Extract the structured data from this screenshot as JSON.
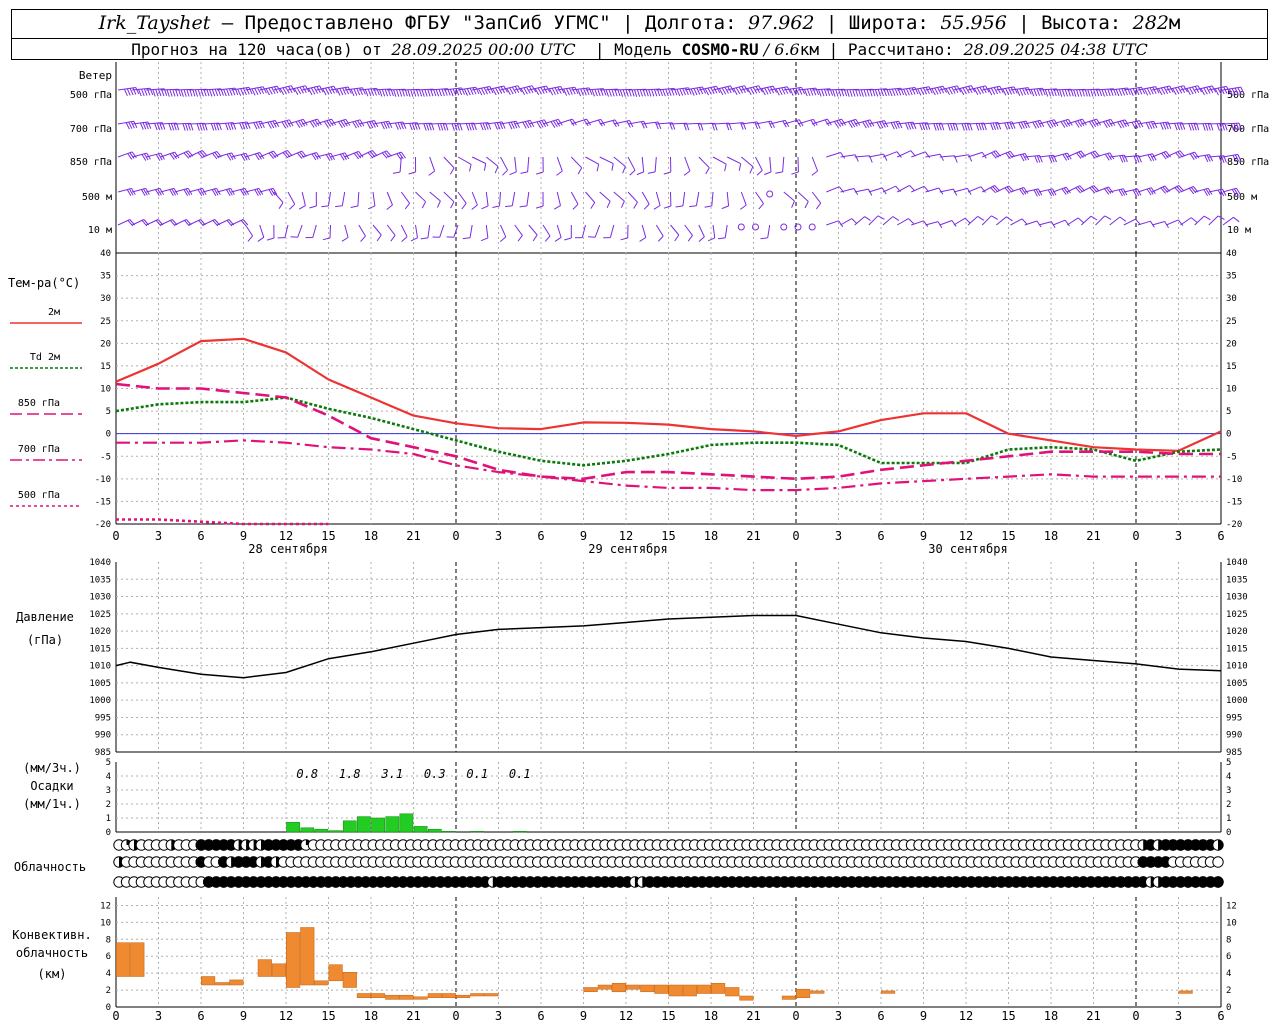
{
  "header": {
    "station": "Irk_Tayshet",
    "provider": " — Предоставлено ФГБУ \"ЗапСиб УГМС\" | Долгота: ",
    "lon": "97.962",
    "lat_label": " | Широта: ",
    "lat": "55.956",
    "alt_label": " | Высота: ",
    "alt": "282",
    "alt_unit": "м",
    "forecast_prefix": "Прогноз на 120 часа(ов) от ",
    "forecast_start": "28.09.2025 00:00 UTC",
    "model_label": "  | Модель ",
    "model": "COSMO-RU",
    "resolution": " / 6.6",
    "res_unit": "км",
    "computed_label": " | Рассчитано: ",
    "computed": "28.09.2025 04:38 UTC"
  },
  "labels": {
    "wind": "Ветер",
    "levels": [
      "500 гПа",
      "700 гПа",
      "850 гПа",
      "500 м",
      "10 м"
    ],
    "temp_title": "Тем-ра(°C)",
    "legend": [
      {
        "label": "2м",
        "color": "#ee3333",
        "dash": ""
      },
      {
        "label": "Td 2м",
        "color": "#0a7a0a",
        "dash": "3,2"
      },
      {
        "label": "850 гПа",
        "color": "#e0127a",
        "dash": "12,5"
      },
      {
        "label": "700 гПа",
        "color": "#e0127a",
        "dash": "12,4,3,4"
      },
      {
        "label": "500 гПа",
        "color": "#e0127a",
        "dash": "3,3"
      }
    ],
    "pressure_title": "Давление",
    "pressure_unit": "(гПа)",
    "precip_unit3": "(мм/3ч.)",
    "precip_title": "Осадки",
    "precip_unit1": "(мм/1ч.)",
    "cloud_title": "Облачность",
    "conv_title1": "Конвективн.",
    "conv_title2": "облачность",
    "conv_unit": "(км)",
    "hour_ticks": [
      "0",
      "3",
      "6",
      "9",
      "12",
      "15",
      "18",
      "21",
      "0",
      "3",
      "6",
      "9",
      "12",
      "15",
      "18",
      "21",
      "0",
      "3",
      "6",
      "9",
      "12",
      "15",
      "18",
      "21",
      "0",
      "3",
      "6"
    ],
    "days": [
      "28 сентября",
      "29 сентября",
      "30 сентября"
    ]
  },
  "chart_data": [
    {
      "type": "line",
      "name": "temperature",
      "ylim": [
        -20,
        40
      ],
      "yticks": [
        "-20",
        "-15",
        "-10",
        "-5",
        "0",
        "5",
        "10",
        "15",
        "20",
        "25",
        "30",
        "35",
        "40"
      ],
      "x_hours": [
        0,
        3,
        6,
        9,
        12,
        15,
        18,
        21,
        24,
        27,
        30,
        33,
        36,
        39,
        42,
        45,
        48,
        51,
        54,
        57,
        60,
        63,
        66,
        69,
        72,
        75,
        78
      ],
      "series": [
        {
          "name": "2м",
          "color": "#ee3333",
          "values": [
            11.5,
            15.5,
            20.5,
            21,
            18,
            12,
            8,
            4,
            2.3,
            1.2,
            1,
            2.5,
            2.4,
            2,
            1,
            0.5,
            -0.5,
            0.5,
            3,
            4.5,
            4.5,
            0,
            -1.5,
            -3,
            -3.5,
            -3.8,
            0.5,
            5
          ]
        },
        {
          "name": "Td 2м",
          "color": "#0a7a0a",
          "values": [
            5,
            6.5,
            7,
            7,
            8,
            5.5,
            3.5,
            1,
            -1.5,
            -4,
            -6,
            -7,
            -6,
            -4.5,
            -2.5,
            -2,
            -2,
            -2.5,
            -6.5,
            -6.5,
            -6.5,
            -3.5,
            -3,
            -3.5,
            -6,
            -4,
            -3.5
          ]
        },
        {
          "name": "850 гПа",
          "color": "#e0127a",
          "values": [
            11,
            10,
            10,
            9,
            8,
            4,
            -1,
            -3,
            -5,
            -8,
            -9.5,
            -10,
            -8.5,
            -8.5,
            -9,
            -9.5,
            -10,
            -9.5,
            -8,
            -7,
            -6,
            -5,
            -4,
            -4,
            -4,
            -4.5,
            -4.5
          ]
        },
        {
          "name": "700 гПа",
          "color": "#e0127a",
          "values": [
            -2,
            -2,
            -2,
            -1.5,
            -2,
            -3,
            -3.5,
            -4.5,
            -7,
            -8.5,
            -9.5,
            -10.5,
            -11.5,
            -12,
            -12,
            -12.5,
            -12.5,
            -12,
            -11,
            -10.5,
            -10,
            -9.5,
            -9,
            -9.5,
            -9.5,
            -9.5,
            -9.5
          ]
        },
        {
          "name": "500 гПа",
          "color": "#e0127a",
          "values": [
            -19,
            -19,
            -19.5,
            -20,
            -20,
            -20,
            null,
            null,
            null,
            null,
            null,
            null,
            null,
            null,
            null,
            null,
            null,
            null,
            null,
            null,
            null,
            null,
            null,
            null,
            null,
            null,
            null
          ]
        }
      ]
    },
    {
      "type": "line",
      "name": "pressure",
      "ylim": [
        985,
        1040
      ],
      "yticks": [
        "985",
        "990",
        "995",
        "1000",
        "1005",
        "1010",
        "1015",
        "1020",
        "1025",
        "1030",
        "1035",
        "1040"
      ],
      "x_hours": [
        0,
        1,
        3,
        6,
        9,
        12,
        15,
        18,
        21,
        24,
        27,
        30,
        33,
        36,
        39,
        42,
        45,
        48,
        51,
        54,
        57,
        60,
        63,
        66,
        69,
        72,
        75,
        78
      ],
      "values": [
        1010,
        1011,
        1009.5,
        1007.5,
        1006.5,
        1008,
        1012,
        1014,
        1016.5,
        1019,
        1020.5,
        1021,
        1021.5,
        1022.5,
        1023.5,
        1024,
        1024.5,
        1024.5,
        1022,
        1019.5,
        1018,
        1017,
        1015,
        1012.5,
        1011.5,
        1010.5,
        1009,
        1008.5
      ]
    },
    {
      "type": "bar",
      "name": "precipitation",
      "ylim": [
        0,
        5
      ],
      "yticks": [
        "0",
        "1",
        "2",
        "3",
        "4",
        "5"
      ],
      "hourly_x": [
        12,
        13,
        14,
        15,
        16,
        17,
        18,
        19,
        20,
        21,
        22,
        23,
        25,
        28
      ],
      "hourly_values": [
        0.7,
        0.3,
        0.2,
        0.1,
        0.8,
        1.1,
        1.0,
        1.1,
        1.3,
        0.4,
        0.2,
        0.05,
        0.05,
        0.05
      ],
      "three_hour_totals": [
        "0.8",
        "1.8",
        "3.1",
        "0.3",
        "0.1",
        "0.1"
      ],
      "three_hour_x": [
        13.5,
        16.5,
        19.5,
        22.5,
        25.5,
        28.5
      ]
    },
    {
      "type": "bar",
      "name": "convective_cloudiness",
      "ylim": [
        0,
        13
      ],
      "yticks": [
        "0",
        "2",
        "4",
        "6",
        "8",
        "10",
        "12"
      ],
      "bars": [
        {
          "x": 0,
          "bottom": 3.6,
          "top": 7.6
        },
        {
          "x": 1,
          "bottom": 3.6,
          "top": 7.6
        },
        {
          "x": 6,
          "bottom": 2.6,
          "top": 3.6
        },
        {
          "x": 7,
          "bottom": 2.6,
          "top": 2.9
        },
        {
          "x": 8,
          "bottom": 2.6,
          "top": 3.2
        },
        {
          "x": 10,
          "bottom": 3.6,
          "top": 5.6
        },
        {
          "x": 11,
          "bottom": 3.6,
          "top": 5.1
        },
        {
          "x": 12,
          "bottom": 2.3,
          "top": 8.8
        },
        {
          "x": 13,
          "bottom": 2.6,
          "top": 9.4
        },
        {
          "x": 14,
          "bottom": 2.6,
          "top": 3.1
        },
        {
          "x": 15,
          "bottom": 3.1,
          "top": 5.0
        },
        {
          "x": 16,
          "bottom": 2.3,
          "top": 4.1
        },
        {
          "x": 17,
          "bottom": 1.1,
          "top": 1.6
        },
        {
          "x": 18,
          "bottom": 1.1,
          "top": 1.6
        },
        {
          "x": 19,
          "bottom": 0.9,
          "top": 1.4
        },
        {
          "x": 20,
          "bottom": 0.9,
          "top": 1.4
        },
        {
          "x": 21,
          "bottom": 0.9,
          "top": 1.2
        },
        {
          "x": 22,
          "bottom": 1.1,
          "top": 1.6
        },
        {
          "x": 23,
          "bottom": 1.1,
          "top": 1.6
        },
        {
          "x": 24,
          "bottom": 1.1,
          "top": 1.4
        },
        {
          "x": 25,
          "bottom": 1.3,
          "top": 1.6
        },
        {
          "x": 26,
          "bottom": 1.3,
          "top": 1.6
        },
        {
          "x": 33,
          "bottom": 1.8,
          "top": 2.3
        },
        {
          "x": 34,
          "bottom": 2.1,
          "top": 2.6
        },
        {
          "x": 35,
          "bottom": 1.8,
          "top": 2.8
        },
        {
          "x": 36,
          "bottom": 2.1,
          "top": 2.6
        },
        {
          "x": 37,
          "bottom": 1.8,
          "top": 2.6
        },
        {
          "x": 38,
          "bottom": 1.6,
          "top": 2.6
        },
        {
          "x": 39,
          "bottom": 1.3,
          "top": 2.6
        },
        {
          "x": 40,
          "bottom": 1.3,
          "top": 2.6
        },
        {
          "x": 41,
          "bottom": 1.6,
          "top": 2.6
        },
        {
          "x": 42,
          "bottom": 1.6,
          "top": 2.8
        },
        {
          "x": 43,
          "bottom": 1.3,
          "top": 2.3
        },
        {
          "x": 44,
          "bottom": 0.8,
          "top": 1.3
        },
        {
          "x": 47,
          "bottom": 0.9,
          "top": 1.3
        },
        {
          "x": 48,
          "bottom": 1.1,
          "top": 2.1
        },
        {
          "x": 49,
          "bottom": 1.6,
          "top": 1.9
        },
        {
          "x": 54,
          "bottom": 1.6,
          "top": 1.9
        },
        {
          "x": 75,
          "bottom": 1.6,
          "top": 1.9
        }
      ]
    }
  ],
  "cloud_rows": [
    "0120000200033333222233333100000000000000000000000000000000000000000000000000000000000000000000000000000000000000000000000000000000000000023233333332",
    "2000000000030032333232000000000000000000000000000000000000000000000000000000000000000000000000000000000000000000000000000000000000000000033330000000",
    "0000000000003333333333333333333333333333333333333323333333333333333332233333333333333333333333333333333333333333333333333333333333333333332233333333"
  ],
  "colors": {
    "wind": "#7a2be0",
    "precip": "#22cc22",
    "conv": "#f08a30",
    "grid": "#b0b0b0",
    "zero_line": "#3333dd"
  }
}
